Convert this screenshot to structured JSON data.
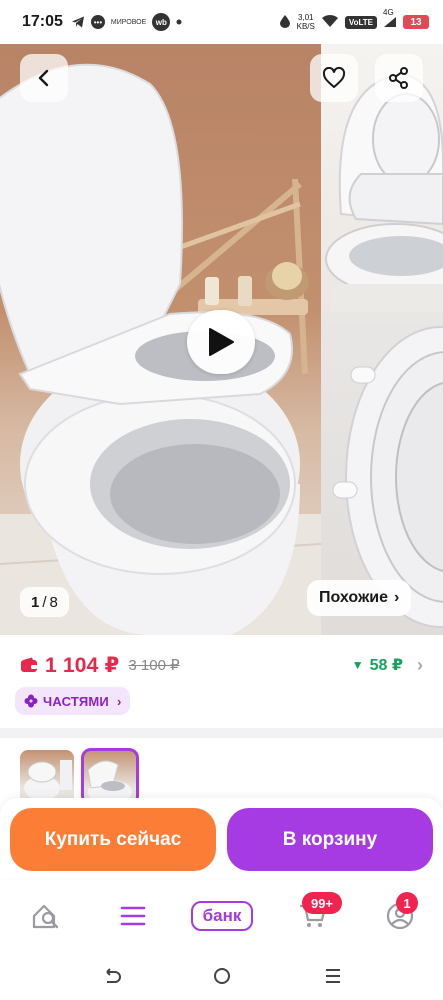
{
  "status_bar": {
    "time": "17:05",
    "net_speed_value": "3,01",
    "net_speed_unit": "KB/S",
    "volte": "VoLTE",
    "network": "4G",
    "battery": "13",
    "wb_label": "wb",
    "bubble_label": "•••",
    "small_label": "МИРОВОЕ"
  },
  "gallery": {
    "counter_current": "1",
    "counter_sep": "/",
    "counter_total": "8",
    "similar_label": "Похожие",
    "similar_chevron": "›"
  },
  "product": {
    "price": "1 104 ₽",
    "old_price": "3 100 ₽",
    "cashback": "58 ₽",
    "cashback_arrow": "▼",
    "parts_label": "ЧАСТЯМИ",
    "parts_chevron": "›",
    "cashback_chevron": "›"
  },
  "actions": {
    "buy_now": "Купить сейчас",
    "add_to_cart": "В корзину"
  },
  "tabbar": {
    "bank_label": "банк",
    "cart_badge": "99+",
    "profile_badge": "1"
  },
  "colors": {
    "price_red": "#e8274a",
    "buy_orange": "#fb7d36",
    "cart_purple": "#a63ae3",
    "cashback_green": "#13a35c",
    "badge_red": "#f0244f"
  },
  "icons": [
    "back-icon",
    "heart-icon",
    "share-icon",
    "play-icon",
    "wallet-icon",
    "flower-icon",
    "home-search-icon",
    "menu-icon",
    "cart-icon",
    "profile-icon",
    "nav-back-icon",
    "nav-home-icon",
    "nav-recents-icon"
  ]
}
